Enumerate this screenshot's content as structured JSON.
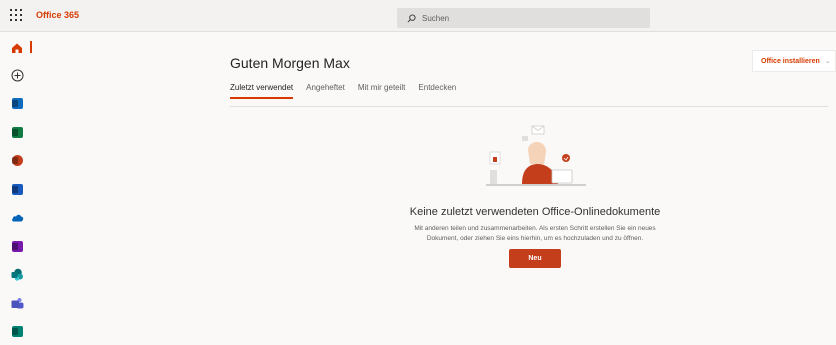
{
  "topbar": {
    "brand": "Office 365",
    "search_placeholder": "Suchen"
  },
  "rail": {
    "items": [
      {
        "name": "home",
        "icon": "home-icon",
        "color": "#d83b01",
        "active": true
      },
      {
        "name": "create",
        "icon": "plus-circle-icon"
      },
      {
        "name": "outlook",
        "icon": "outlook-icon",
        "color": "#0f6cbd"
      },
      {
        "name": "excel",
        "icon": "excel-icon",
        "color": "#107c41"
      },
      {
        "name": "powerpoint",
        "icon": "powerpoint-icon",
        "color": "#c43e1c"
      },
      {
        "name": "word",
        "icon": "word-icon",
        "color": "#185abd"
      },
      {
        "name": "onedrive",
        "icon": "onedrive-icon",
        "color": "#0364b8"
      },
      {
        "name": "onenote",
        "icon": "onenote-icon",
        "color": "#7719aa"
      },
      {
        "name": "sharepoint",
        "icon": "sharepoint-icon",
        "color": "#038387"
      },
      {
        "name": "teams",
        "icon": "teams-icon",
        "color": "#4b53bc"
      },
      {
        "name": "sway",
        "icon": "sway-icon",
        "color": "#008272"
      }
    ]
  },
  "main": {
    "greeting": "Guten Morgen Max",
    "tabs": [
      {
        "label": "Zuletzt verwendet",
        "active": true
      },
      {
        "label": "Angeheftet"
      },
      {
        "label": "Mit mir geteilt"
      },
      {
        "label": "Entdecken"
      }
    ],
    "install_button": "Office installieren",
    "empty_state": {
      "title": "Keine zuletzt verwendeten Office-Onlinedokumente",
      "description_line1": "Mit anderen teilen und zusammenarbeiten. Als ersten Schritt erstellen Sie ein neues",
      "description_line2": "Dokument, oder ziehen Sie eins hierhin, um es hochzuladen und zu öffnen.",
      "new_button": "Neu"
    }
  },
  "colors": {
    "accent": "#d83b01",
    "new_button": "#c43e1c"
  }
}
